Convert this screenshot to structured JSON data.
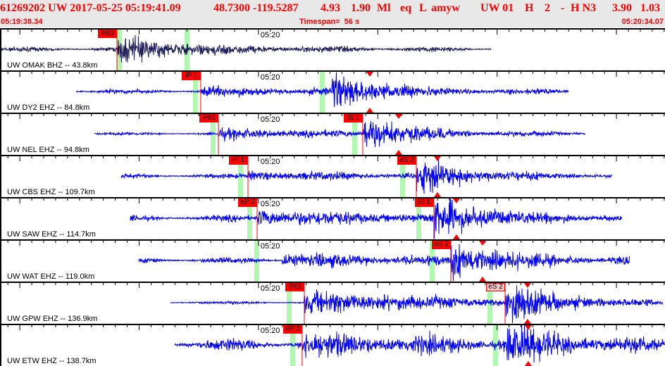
{
  "header": {
    "title_parts": [
      "61269202 UW 2017-05-25 05:19:41.09",
      "48.7300 -119.5287",
      "4.93",
      "1.90",
      "Ml",
      "eq",
      "L",
      "amyw",
      "UW 01",
      "H",
      "2",
      "-",
      "H N3",
      "3.90",
      "1.03"
    ],
    "start_time": "05:19:38.34",
    "timespan": "Timespan=  56 s",
    "end_time": "05:20:34.07"
  },
  "time_axis": {
    "start_s": 0,
    "end_s": 55.73,
    "minute_mark_s": 21.66,
    "minute_label": "05:20",
    "major_tick_s": 10,
    "minor_tick_s": 1
  },
  "colors": {
    "pick": "#ff0000",
    "predicted": "#b0f8b0",
    "trace": "#0000ff",
    "trace_selected": "#1a1a5a",
    "text": "#ff0000"
  },
  "traces": [
    {
      "label": "UW OMAK BHZ -- 43.8km",
      "selected": true,
      "start": 0,
      "end": 41.15,
      "noise": 3,
      "p_amp": 14,
      "s_amp": 0,
      "s_onset": 16.8,
      "peak": null,
      "picks": [
        {
          "label": "iPd1",
          "t": 9.8
        }
      ],
      "predicted": [
        9.8,
        15.47
      ]
    },
    {
      "label": "UW DY2 EHZ -- 84.8km",
      "selected": false,
      "start": 6.38,
      "end": 47.58,
      "noise": 3,
      "p_amp": 4,
      "s_amp": 24,
      "s_onset": 27.75,
      "peak": 30.99,
      "picks": [
        {
          "label": "iP 1",
          "t": 16.82
        }
      ],
      "predicted": [
        16.17,
        26.8
      ]
    },
    {
      "label": "UW NEL EHZ -- 94.8km",
      "selected": false,
      "start": 7.91,
      "end": 49.0,
      "noise": 2,
      "p_amp": 5,
      "s_amp": 22,
      "s_onset": 30.4,
      "peak": 33.41,
      "picks": [
        {
          "label": "iPd1",
          "t": 18.3
        },
        {
          "label": "iS 1",
          "t": 30.4
        }
      ],
      "predicted": [
        17.65,
        29.52
      ]
    },
    {
      "label": "UW CBS EHZ -- 109.7km",
      "selected": false,
      "start": 10.15,
      "end": 51.24,
      "noise": 3,
      "p_amp": 4,
      "s_amp": 22,
      "s_onset": 34.89,
      "peak": 36.66,
      "picks": [
        {
          "label": "iP 1",
          "t": 20.78
        },
        {
          "label": "eS 2",
          "t": 34.89
        }
      ],
      "predicted": [
        19.95,
        33.53
      ]
    },
    {
      "label": "UW SAW EHZ -- 114.7km",
      "selected": false,
      "start": 10.92,
      "end": 52.07,
      "noise": 4,
      "p_amp": 8,
      "s_amp": 24,
      "s_onset": 36.36,
      "peak": 38.25,
      "picks": [
        {
          "label": "eP 2",
          "t": 21.55
        },
        {
          "label": "iS 1",
          "t": 36.36
        }
      ],
      "predicted": [
        20.72,
        34.89
      ]
    },
    {
      "label": "UW WAT EHZ -- 119.0km",
      "selected": false,
      "start": 11.63,
      "end": 52.72,
      "noise": 4,
      "p_amp": 6,
      "s_amp": 24,
      "s_onset": 37.78,
      "peak": 40.44,
      "picks": [
        {
          "label": "eS 2",
          "t": 37.78
        }
      ],
      "predicted": [
        21.31,
        36.01
      ]
    },
    {
      "label": "UW GPW EHZ -- 136.9km",
      "selected": false,
      "start": 14.29,
      "end": 55.49,
      "noise": 2,
      "p_amp": 13,
      "s_amp": 24,
      "s_onset": 42.33,
      "peak": 44.21,
      "picks": [
        {
          "label": "iPd1",
          "t": 25.5
        },
        {
          "label": "eS 2",
          "t": 42.33,
          "selected": true
        }
      ],
      "predicted": [
        24.03,
        40.85
      ]
    },
    {
      "label": "UW ETW EHZ -- 138.7km",
      "selected": false,
      "start": 14.64,
      "end": 55.73,
      "noise": 8,
      "p_amp": 9,
      "s_amp": 22,
      "s_onset": 42.5,
      "peak": 44.27,
      "picks": [
        {
          "label": "eP 2",
          "t": 25.32
        }
      ],
      "predicted": [
        24.32,
        41.32
      ]
    }
  ]
}
